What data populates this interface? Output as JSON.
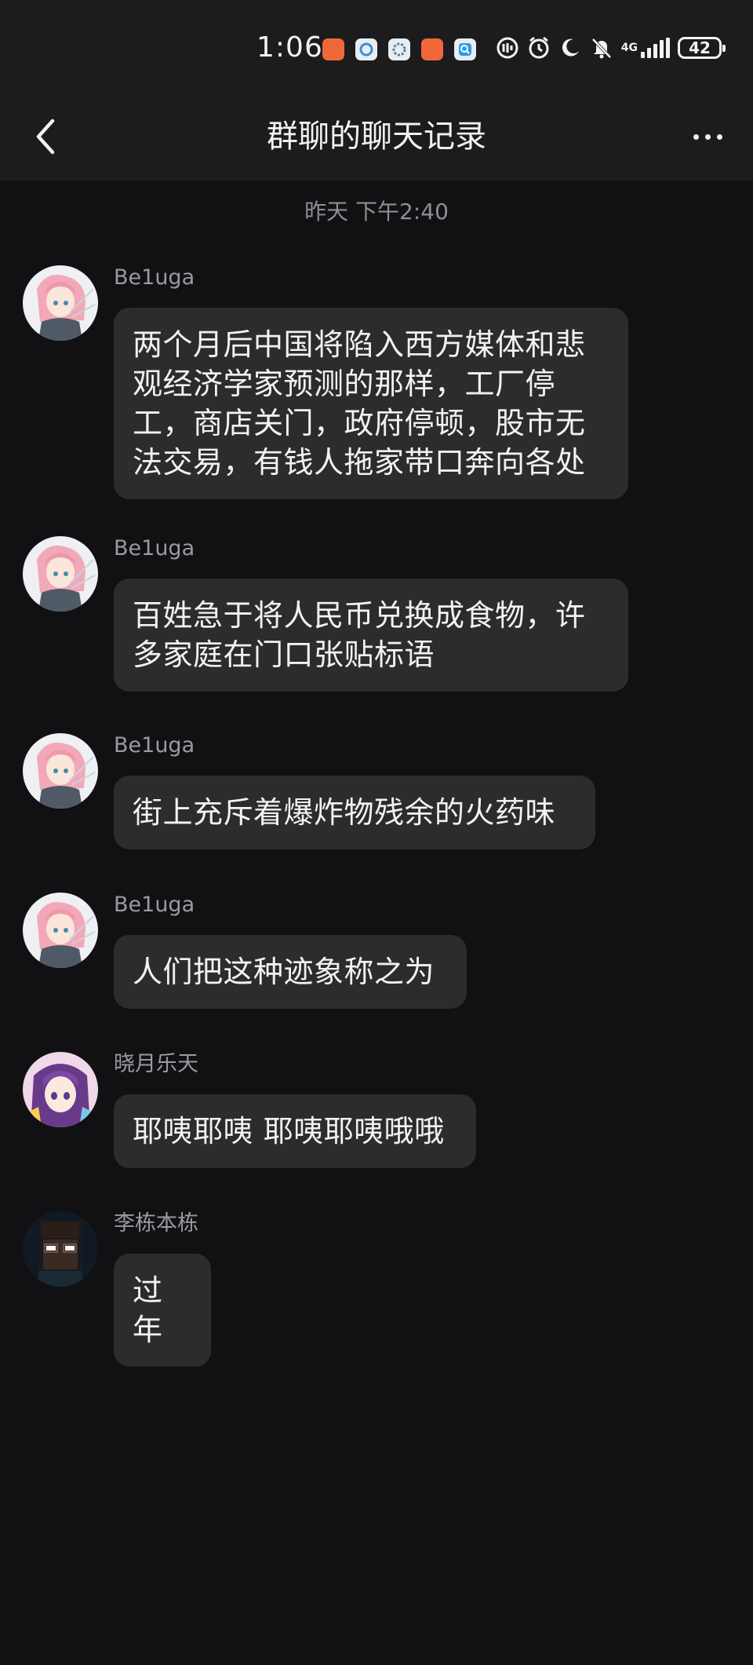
{
  "status_bar": {
    "time": "1:06",
    "network": "4G",
    "battery": "42"
  },
  "header": {
    "title": "群聊的聊天记录"
  },
  "chat": {
    "timestamp": "昨天 下午2:40",
    "messages": [
      {
        "sender": "Be1uga",
        "text": "两个月后中国将陷入西方媒体和悲观经济学家预测的那样，工厂停工，商店关门，政府停顿，股市无法交易，有钱人拖家带口奔向各处"
      },
      {
        "sender": "Be1uga",
        "text": "百姓急于将人民币兑换成食物，许多家庭在门口张贴标语"
      },
      {
        "sender": "Be1uga",
        "text": "街上充斥着爆炸物残余的火药味"
      },
      {
        "sender": "Be1uga",
        "text": "人们把这种迹象称之为"
      },
      {
        "sender": "晓月乐天",
        "text": "耶咦耶咦 耶咦耶咦哦哦"
      },
      {
        "sender": "李栋本栋",
        "text": "过年"
      }
    ]
  }
}
